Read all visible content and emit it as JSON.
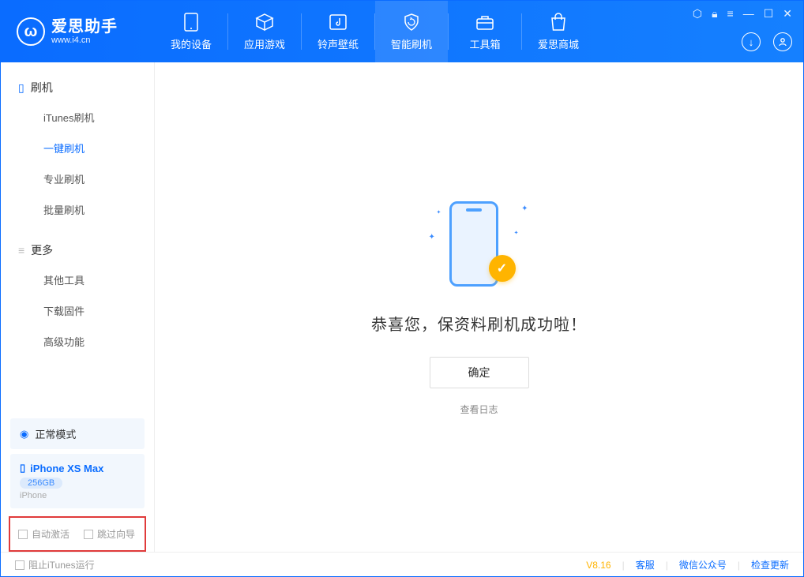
{
  "app": {
    "title": "爱思助手",
    "subtitle": "www.i4.cn"
  },
  "nav": {
    "device": "我的设备",
    "apps": "应用游戏",
    "ring": "铃声壁纸",
    "flash": "智能刷机",
    "tools": "工具箱",
    "store": "爱思商城"
  },
  "sidebar": {
    "section1": "刷机",
    "items1": {
      "itunes": "iTunes刷机",
      "oneclick": "一键刷机",
      "pro": "专业刷机",
      "batch": "批量刷机"
    },
    "section2": "更多",
    "items2": {
      "other": "其他工具",
      "firmware": "下载固件",
      "advanced": "高级功能"
    }
  },
  "device": {
    "mode": "正常模式",
    "name": "iPhone XS Max",
    "capacity": "256GB",
    "type": "iPhone"
  },
  "options": {
    "auto_activate": "自动激活",
    "skip_guide": "跳过向导"
  },
  "main": {
    "success": "恭喜您，保资料刷机成功啦！",
    "ok": "确定",
    "log": "查看日志"
  },
  "footer": {
    "block_itunes": "阻止iTunes运行",
    "version": "V8.16",
    "cs": "客服",
    "wechat": "微信公众号",
    "update": "检查更新"
  }
}
